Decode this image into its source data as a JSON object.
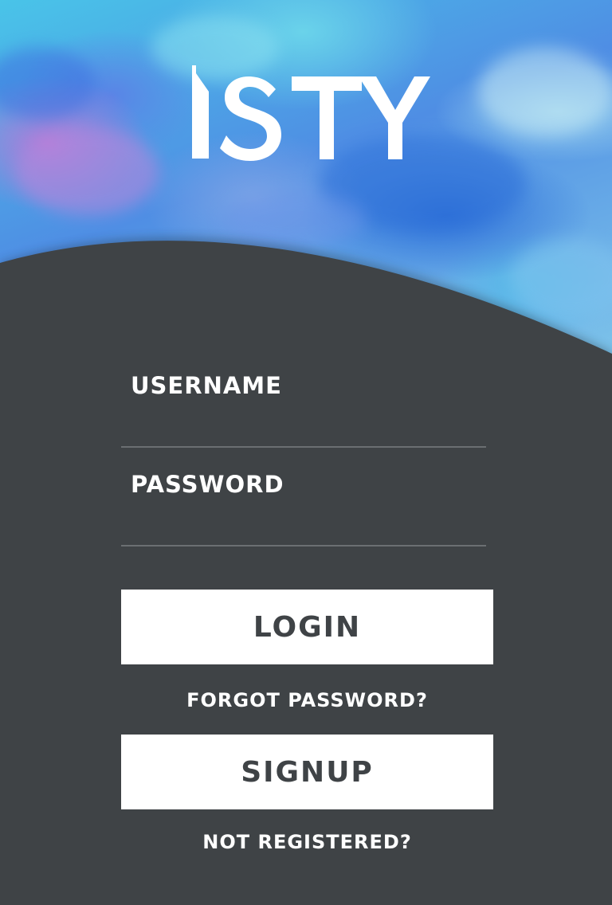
{
  "app": {
    "logo_text": "ISTY"
  },
  "form": {
    "username": {
      "label": "USERNAME",
      "value": ""
    },
    "password": {
      "label": "PASSWORD",
      "value": ""
    }
  },
  "actions": {
    "login_label": "LOGIN",
    "forgot_label": "FORGOT PASSWORD?",
    "signup_label": "SIGNUP",
    "not_registered_label": "NOT REGISTERED?"
  },
  "colors": {
    "panel": "#3f4346",
    "button_bg": "#ffffff",
    "button_text": "#3f4346",
    "underline": "#6b6f72",
    "accent_blue": "#4f8ee4",
    "accent_cyan": "#49c4e8"
  }
}
